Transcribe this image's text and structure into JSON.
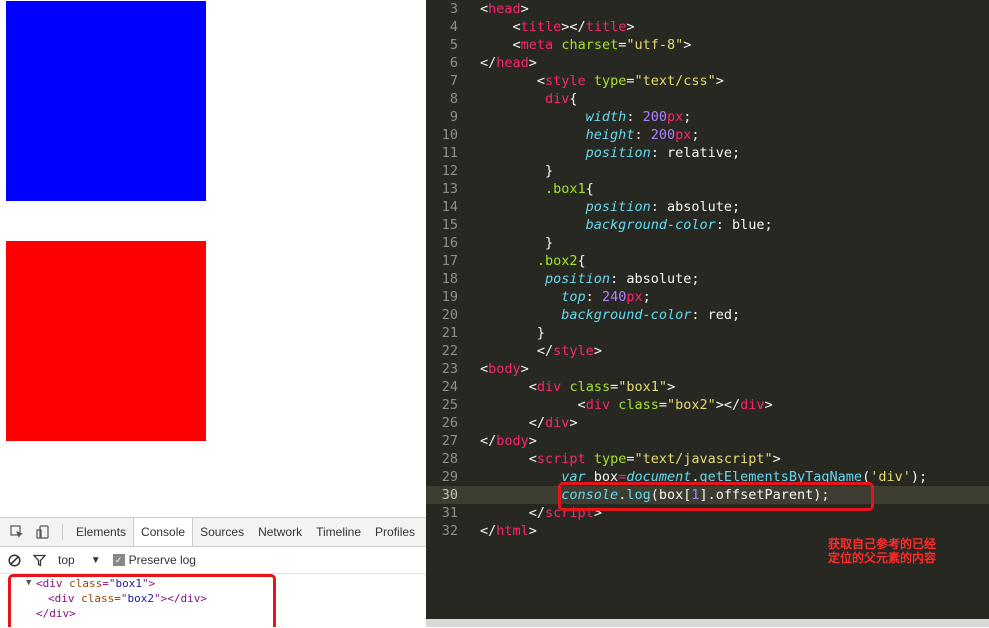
{
  "colors": {
    "box1": "#0000ff",
    "box2": "#ff0000",
    "highlight": "#e6141b"
  },
  "devtools": {
    "tabs": [
      "Elements",
      "Console",
      "Sources",
      "Network",
      "Timeline",
      "Profiles"
    ],
    "active_tab": "Console",
    "icons": [
      "inspect-icon",
      "device-icon",
      "clear-icon",
      "filter-icon"
    ],
    "context": "top",
    "preserve_log": "Preserve log",
    "output": {
      "l1_open": "<div ",
      "l1_attr": "class",
      "l1_eq": "=\"",
      "l1_val": "box1",
      "l1_close": "\">",
      "l2_open": "<div ",
      "l2_attr": "class",
      "l2_eq": "=\"",
      "l2_val": "box2",
      "l2_close": "\"></div>",
      "l3": "</div>"
    }
  },
  "editor": {
    "line_numbers": [
      "3",
      "4",
      "5",
      "6",
      "7",
      "8",
      "9",
      "10",
      "11",
      "12",
      "13",
      "14",
      "15",
      "16",
      "17",
      "18",
      "19",
      "20",
      "21",
      "22",
      "23",
      "24",
      "25",
      "26",
      "27",
      "28",
      "29",
      "30",
      "31",
      "32"
    ],
    "active_line": "30"
  },
  "annotation": {
    "line1": "获取自己参考的已经",
    "line2": "定位的父元素的内容"
  }
}
